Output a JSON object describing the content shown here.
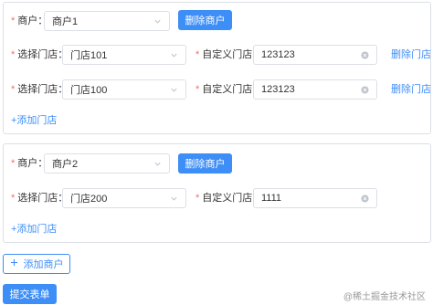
{
  "labels": {
    "merchant": "商户：",
    "choose_store": "选择门店：",
    "custom_store": "自定义门店：",
    "required_mark": "*"
  },
  "merchants": [
    {
      "merchant_value": "商户1",
      "delete_merchant_label": "删除商户",
      "stores": [
        {
          "store_value": "门店101",
          "custom_value": "123123",
          "delete_label": "删除门店"
        },
        {
          "store_value": "门店100",
          "custom_value": "123123",
          "delete_label": "删除门店"
        }
      ],
      "add_store_label": "+添加门店"
    },
    {
      "merchant_value": "商户2",
      "delete_merchant_label": "删除商户",
      "stores": [
        {
          "store_value": "门店200",
          "custom_value": "1111",
          "delete_label": ""
        }
      ],
      "add_store_label": "+添加门店"
    }
  ],
  "add_merchant_label": "添加商户",
  "submit_label": "提交表单",
  "watermark": "@稀土掘金技术社区",
  "colors": {
    "primary": "#3e8ef7",
    "required": "#f56c6c",
    "border": "#dcdfe6"
  },
  "icons": {
    "select_arrow": "chevron-down-icon",
    "clear": "circle-close-icon",
    "add": "plus-icon"
  }
}
